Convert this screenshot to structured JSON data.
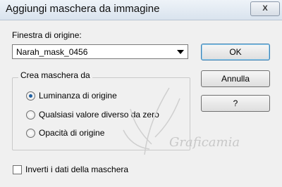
{
  "window": {
    "title": "Aggiungi maschera da immagine",
    "close_label": "X"
  },
  "source": {
    "label": "Finestra di origine:",
    "selected": "Narah_mask_0456"
  },
  "buttons": {
    "ok": "OK",
    "cancel": "Annulla",
    "help": "?"
  },
  "group": {
    "title": "Crea maschera da",
    "options": [
      {
        "label": "Luminanza di origine",
        "selected": true
      },
      {
        "label": "Qualsiasi valore diverso da zero",
        "selected": false
      },
      {
        "label": "Opacità di origine",
        "selected": false
      }
    ]
  },
  "invert": {
    "label": "Inverti i dati della maschera",
    "checked": false
  },
  "watermark": {
    "text": "Graficamia"
  }
}
